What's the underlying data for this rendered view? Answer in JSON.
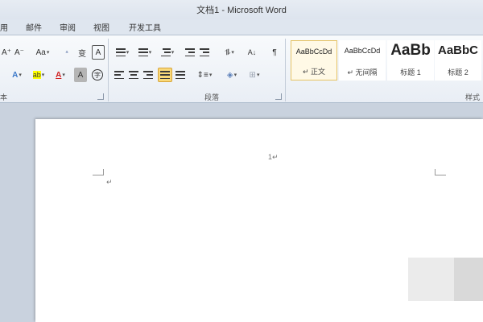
{
  "window": {
    "title": "文档1 - Microsoft Word"
  },
  "tabs": [
    {
      "label": "用"
    },
    {
      "label": "邮件"
    },
    {
      "label": "审阅"
    },
    {
      "label": "视图"
    },
    {
      "label": "开发工具"
    }
  ],
  "ribbon": {
    "font_group": {
      "grow_label": "A⁺",
      "shrink_label": "A⁻",
      "case_label": "Aa",
      "phonetic_label": "变",
      "border_char_label": "A",
      "text_effect_label": "A",
      "highlight_label": "ab",
      "font_color_label": "A",
      "char_shade_label": "A",
      "enclose_label": "字",
      "group_label": "本"
    },
    "paragraph_group": {
      "group_label": "段落",
      "sort_label": "A↓"
    },
    "styles_group": {
      "group_label": "样式",
      "styles": [
        {
          "sample": "AaBbCcDd",
          "name": "↵ 正文",
          "active": true
        },
        {
          "sample": "AaBbCcDd",
          "name": "↵ 无间隔",
          "active": false
        },
        {
          "sample": "AaBb",
          "name": "标题 1",
          "active": false
        },
        {
          "sample": "AaBbC",
          "name": "标题 2",
          "active": false
        }
      ]
    }
  },
  "document": {
    "header_mark": "1↵",
    "paragraph_mark": "↵"
  }
}
